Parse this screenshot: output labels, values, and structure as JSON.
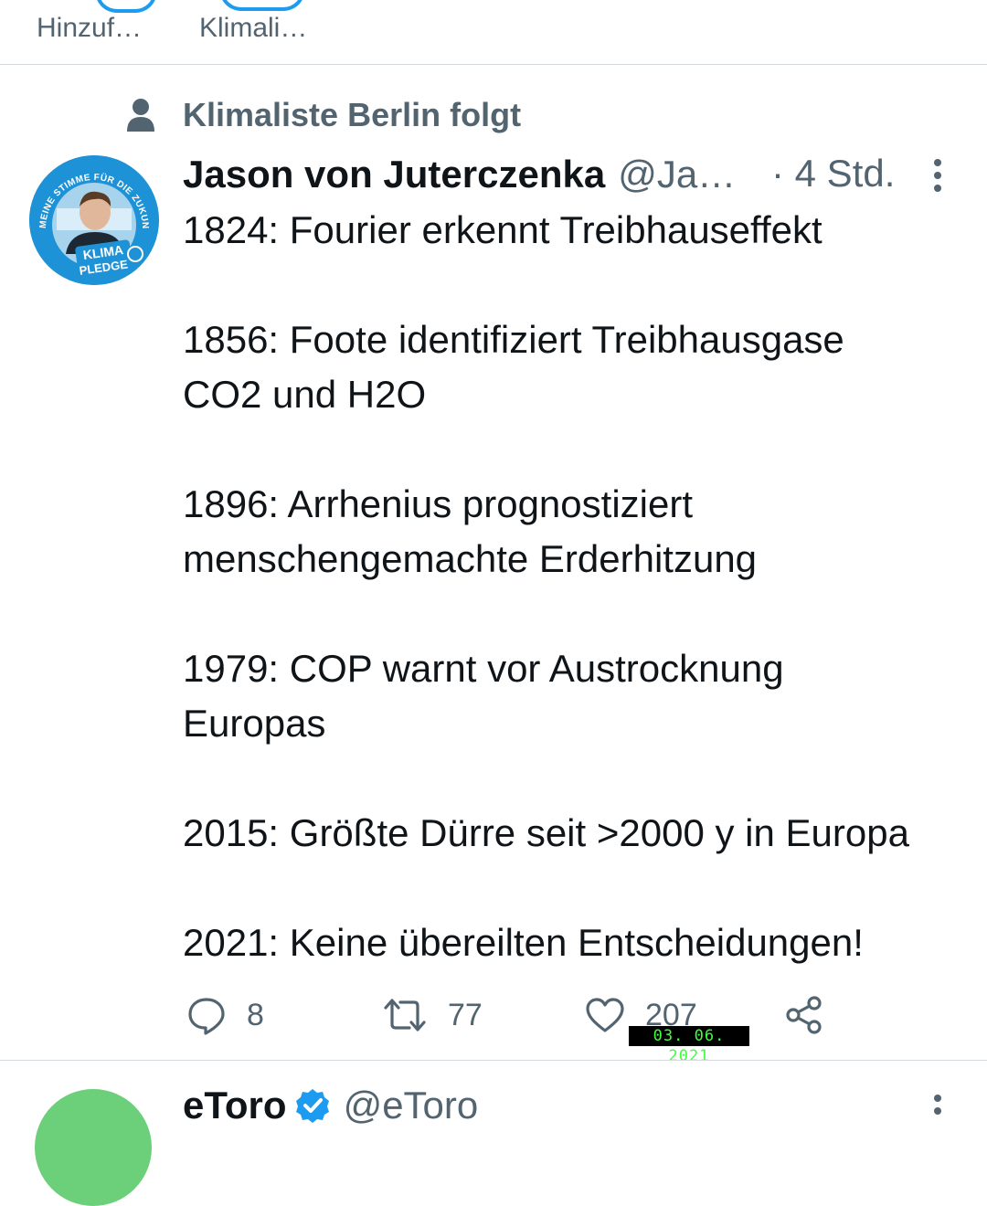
{
  "fleets": [
    {
      "label": "Hinzuf…"
    },
    {
      "label": "Klimali…"
    }
  ],
  "tweet": {
    "social_context": "Klimaliste Berlin folgt",
    "author_name": "Jason von Juterczenka",
    "author_handle": "@Ja…",
    "time": "· 4 Std.",
    "lines": [
      "1824: Fourier erkennt Treibhauseffekt",
      "",
      "1856: Foote identifiziert Treibhausgase",
      "CO2 und H2O",
      "",
      "1896: Arrhenius prognostiziert",
      "menschengemachte Erderhitzung",
      "",
      "1979: COP warnt vor Austrocknung",
      "Europas",
      "",
      "2015: Größte Dürre seit >2000 y in Europa",
      "",
      "2021: Keine übereilten Entscheidungen!"
    ],
    "avatar_text": {
      "top": "MEINE STIMME FÜR DIE ZUKUNFT",
      "badge_1": "KLIMA",
      "badge_2": "PLEDGE"
    },
    "replies": "8",
    "retweets": "77",
    "likes": "207"
  },
  "photo_datestamp": "03. 06. 2021",
  "next_tweet": {
    "author_name": "eToro",
    "author_handle": "@eToro"
  },
  "colors": {
    "accent": "#1d9bf0",
    "muted": "#536471",
    "text": "#0f1419",
    "divider": "#d4d9de"
  }
}
